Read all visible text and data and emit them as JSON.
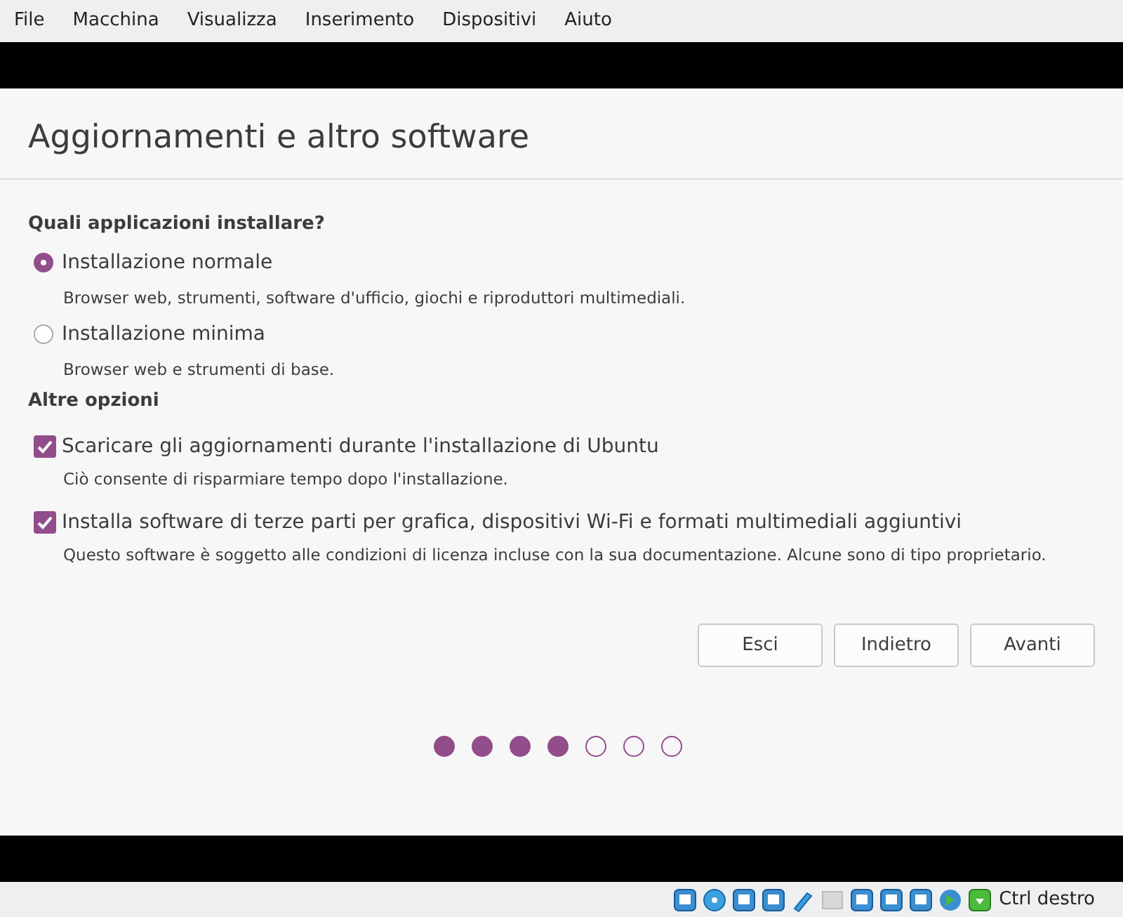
{
  "menu": [
    "File",
    "Macchina",
    "Visualizza",
    "Inserimento",
    "Dispositivi",
    "Aiuto"
  ],
  "title": "Aggiornamenti e altro software",
  "install_heading": "Quali applicazioni installare?",
  "install_options": [
    {
      "label": "Installazione normale",
      "description": "Browser web, strumenti, software d'ufficio, giochi e riproduttori multimediali.",
      "selected": true
    },
    {
      "label": "Installazione minima",
      "description": "Browser web e strumenti di base.",
      "selected": false
    }
  ],
  "other_heading": "Altre opzioni",
  "other_options": [
    {
      "label": "Scaricare gli aggiornamenti durante l'installazione di Ubuntu",
      "description": "Ciò consente di risparmiare tempo dopo l'installazione.",
      "checked": true
    },
    {
      "label": "Installa software di terze parti per grafica, dispositivi Wi-Fi e formati multimediali aggiuntivi",
      "description": "Questo software è soggetto alle condizioni di licenza incluse con la sua documentazione. Alcune sono di tipo proprietario.",
      "checked": true
    }
  ],
  "buttons": [
    "Esci",
    "Indietro",
    "Avanti"
  ],
  "steps": [
    {
      "done": true
    },
    {
      "done": true
    },
    {
      "done": true
    },
    {
      "done": true
    },
    {
      "done": false
    },
    {
      "done": false
    },
    {
      "done": false
    }
  ],
  "status_bar": {
    "host_key": "Ctrl destro"
  }
}
